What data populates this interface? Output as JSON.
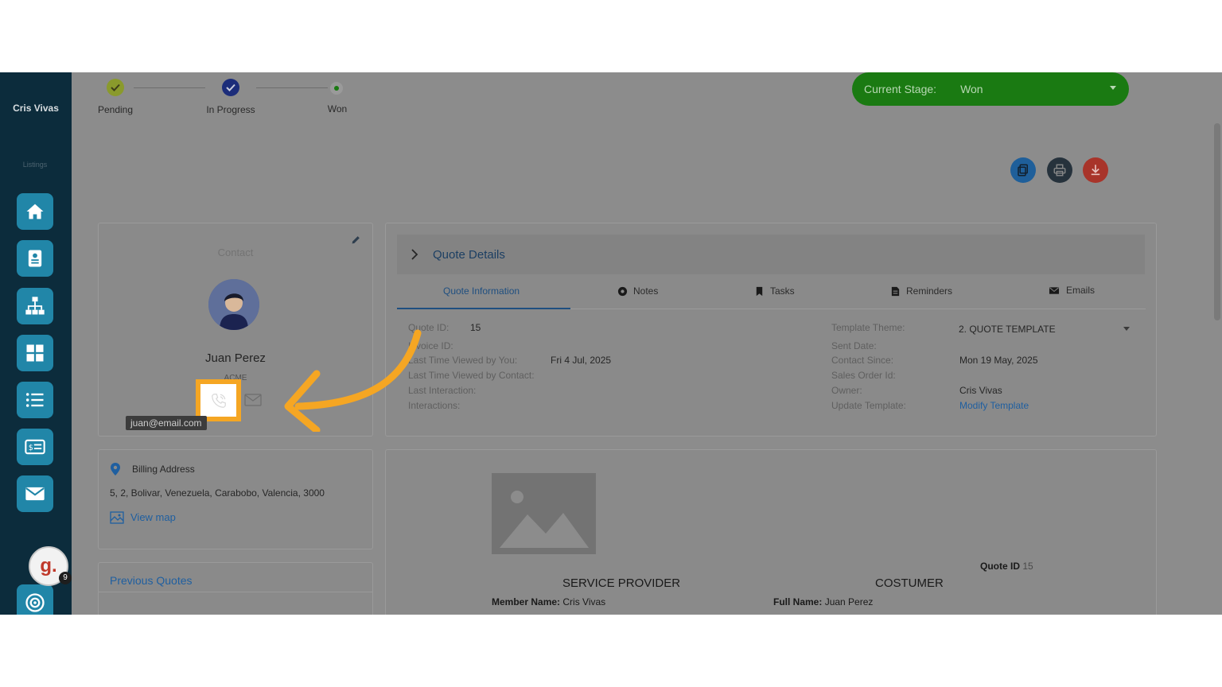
{
  "sidebar": {
    "user_name": "Cris Vivas",
    "section_label": "Listings",
    "items": [
      {
        "icon": "home-icon"
      },
      {
        "icon": "contact-card-icon"
      },
      {
        "icon": "org-chart-icon"
      },
      {
        "icon": "grid-icon"
      },
      {
        "icon": "list-icon"
      },
      {
        "icon": "invoice-icon"
      },
      {
        "icon": "mail-icon"
      },
      {
        "icon": "target-icon"
      }
    ],
    "avatar_letter": "g.",
    "notification_count": "9"
  },
  "stages": {
    "items": [
      {
        "label": "Pending",
        "status": "done",
        "color": "#8a9a2c"
      },
      {
        "label": "In Progress",
        "status": "current",
        "color": "#1c2d7a"
      },
      {
        "label": "Won",
        "status": "next",
        "color": "#1a7a12"
      }
    ],
    "current_label": "Current Stage:",
    "current_value": "Won"
  },
  "contact": {
    "header": "Contact",
    "name": "Juan Perez",
    "company": "ACME",
    "email_tooltip": "juan@email.com"
  },
  "billing": {
    "title": "Billing Address",
    "address": "5, 2, Bolivar, Venezuela, Carabobo, Valencia, 3000",
    "view_map": "View map"
  },
  "previous_quotes": {
    "title": "Previous Quotes"
  },
  "quote_details": {
    "title": "Quote Details",
    "tabs": [
      {
        "label": "Quote Information",
        "icon": "",
        "active": true
      },
      {
        "label": "Notes",
        "icon": "notes-icon",
        "active": false
      },
      {
        "label": "Tasks",
        "icon": "bookmark-icon",
        "active": false
      },
      {
        "label": "Reminders",
        "icon": "document-icon",
        "active": false
      },
      {
        "label": "Emails",
        "icon": "envelope-icon",
        "active": false
      }
    ],
    "left_fields": [
      {
        "label": "Quote ID:",
        "value": "15"
      },
      {
        "label": "Invoice ID:",
        "value": ""
      },
      {
        "label": "Last Time Viewed by You:",
        "value": "Fri 4 Jul, 2025"
      },
      {
        "label": "Last Time Viewed by Contact:",
        "value": ""
      },
      {
        "label": "Last Interaction:",
        "value": ""
      },
      {
        "label": "Interactions:",
        "value": ""
      }
    ],
    "right_fields": [
      {
        "label": "Template Theme:",
        "value": "2. QUOTE TEMPLATE"
      },
      {
        "label": "Sent Date:",
        "value": ""
      },
      {
        "label": "Contact Since:",
        "value": "Mon 19 May, 2025"
      },
      {
        "label": "Sales Order Id:",
        "value": ""
      },
      {
        "label": "Owner:",
        "value": "Cris Vivas"
      },
      {
        "label": "Update Template:",
        "value": "Modify Template"
      }
    ]
  },
  "preview": {
    "quote_id_label": "Quote ID",
    "quote_id_value": "15",
    "provider_heading": "SERVICE PROVIDER",
    "customer_heading": "COSTUMER",
    "member_label": "Member Name:",
    "member_value": "Cris Vivas",
    "full_name_label": "Full Name:",
    "full_name_value": "Juan Perez"
  },
  "colors": {
    "overlay": "#8c8c8c",
    "sidebar": "#0c2c3c",
    "sidebar_button": "#2186a8",
    "stage_green": "#1a7a12",
    "highlight": "#f5a623",
    "link": "#1f5fa0"
  }
}
